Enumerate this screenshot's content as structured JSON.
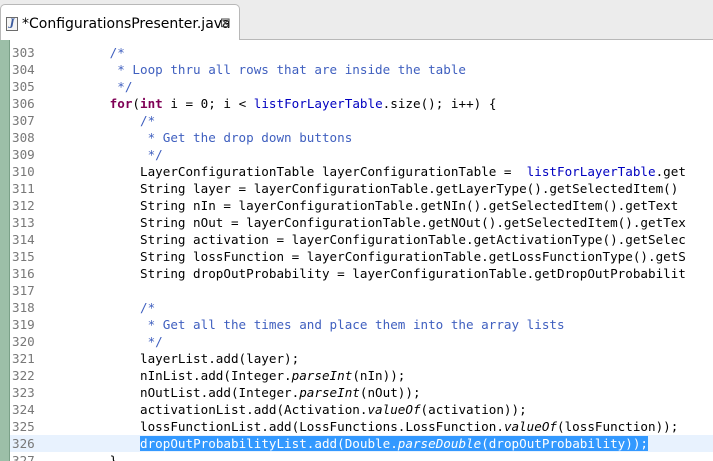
{
  "tab": {
    "icon": "java-file-icon",
    "icon_letter": "J",
    "title": "*ConfigurationsPresenter.java",
    "close_glyph": "⊠"
  },
  "editor": {
    "colors": {
      "keyword": "#7f0055",
      "comment": "#3f5fbf",
      "field": "#0000c0",
      "selection": "#3399ff",
      "current_line": "#e8f2fe"
    },
    "lines": [
      {
        "n": "303",
        "code": "        /*"
      },
      {
        "n": "304",
        "code": "         * Loop thru all rows that are inside the table"
      },
      {
        "n": "305",
        "code": "         */"
      },
      {
        "n": "306",
        "code": "        for(int i = 0; i < listForLayerTable.size(); i++) {"
      },
      {
        "n": "307",
        "code": "            /*"
      },
      {
        "n": "308",
        "code": "             * Get the drop down buttons"
      },
      {
        "n": "309",
        "code": "             */"
      },
      {
        "n": "310",
        "code": "            LayerConfigurationTable layerConfigurationTable =  listForLayerTable.get"
      },
      {
        "n": "311",
        "code": "            String layer = layerConfigurationTable.getLayerType().getSelectedItem()"
      },
      {
        "n": "312",
        "code": "            String nIn = layerConfigurationTable.getNIn().getSelectedItem().getText"
      },
      {
        "n": "313",
        "code": "            String nOut = layerConfigurationTable.getNOut().getSelectedItem().getTex"
      },
      {
        "n": "314",
        "code": "            String activation = layerConfigurationTable.getActivationType().getSelec"
      },
      {
        "n": "315",
        "code": "            String lossFunction = layerConfigurationTable.getLossFunctionType().getS"
      },
      {
        "n": "316",
        "code": "            String dropOutProbability = layerConfigurationTable.getDropOutProbabilit"
      },
      {
        "n": "317",
        "code": ""
      },
      {
        "n": "318",
        "code": "            /*"
      },
      {
        "n": "319",
        "code": "             * Get all the times and place them into the array lists"
      },
      {
        "n": "320",
        "code": "             */"
      },
      {
        "n": "321",
        "code": "            layerList.add(layer);"
      },
      {
        "n": "322",
        "code": "            nInList.add(Integer.parseInt(nIn));"
      },
      {
        "n": "323",
        "code": "            nOutList.add(Integer.parseInt(nOut));"
      },
      {
        "n": "324",
        "code": "            activationList.add(Activation.valueOf(activation));"
      },
      {
        "n": "325",
        "code": "            lossFunctionList.add(LossFunctions.LossFunction.valueOf(lossFunction));"
      },
      {
        "n": "326",
        "code": "            dropOutProbabilityList.add(Double.parseDouble(dropOutProbability));"
      },
      {
        "n": "327",
        "code": "        }"
      }
    ]
  }
}
